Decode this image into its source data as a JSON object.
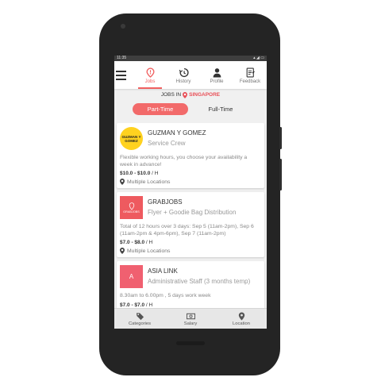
{
  "status": {
    "time": "11:35"
  },
  "nav": {
    "tabs": [
      {
        "label": "Jobs",
        "icon": "jobs-pin-icon"
      },
      {
        "label": "History",
        "icon": "history-icon"
      },
      {
        "label": "Profile",
        "icon": "profile-icon"
      },
      {
        "label": "Feedback",
        "icon": "feedback-icon"
      }
    ],
    "active": "Jobs"
  },
  "location_bar": {
    "prefix": "JOBS IN",
    "location": "SINGAPORE"
  },
  "toggle": {
    "part_time": "Part-Time",
    "full_time": "Full-Time",
    "selected": "Part-Time"
  },
  "jobs": [
    {
      "company": "GUZMAN Y GOMEZ",
      "role": "Service Crew",
      "description": "Flexible working hours, you choose your availability a week in advance!",
      "pay": "$10.0 - $10.0",
      "pay_unit": "/ H",
      "location": "Multiple Locations",
      "logo_text": "GUZMAN Y GOMEZ"
    },
    {
      "company": "GRABJOBS",
      "role": "Flyer + Goodie Bag Distribution",
      "description": "Total of 12 hours over 3 days: Sep 5 (11am-2pm), Sep 6 (11am-2pm & 4pm-6pm), Sep 7 (11am-2pm)",
      "pay": "$7.0 - $8.0",
      "pay_unit": "/ H",
      "location": "Multiple Locations",
      "logo_text": "GRABJOBS"
    },
    {
      "company": "ASIA LINK",
      "role": "Administrative Staff (3 months temp)",
      "description": "8.30am to 6.00pm , 5 days work week",
      "pay": "$7.0 - $7.0",
      "pay_unit": "/ H",
      "logo_text": "A"
    }
  ],
  "bottom_nav": [
    {
      "label": "Categories",
      "icon": "tag-icon"
    },
    {
      "label": "Salary",
      "icon": "cash-icon"
    },
    {
      "label": "Location",
      "icon": "location-pin-icon"
    }
  ],
  "colors": {
    "accent": "#f06060",
    "toggle_active": "#f26a6a",
    "grab_logo": "#ee5a5f",
    "gyg_logo": "#ffd21f"
  }
}
